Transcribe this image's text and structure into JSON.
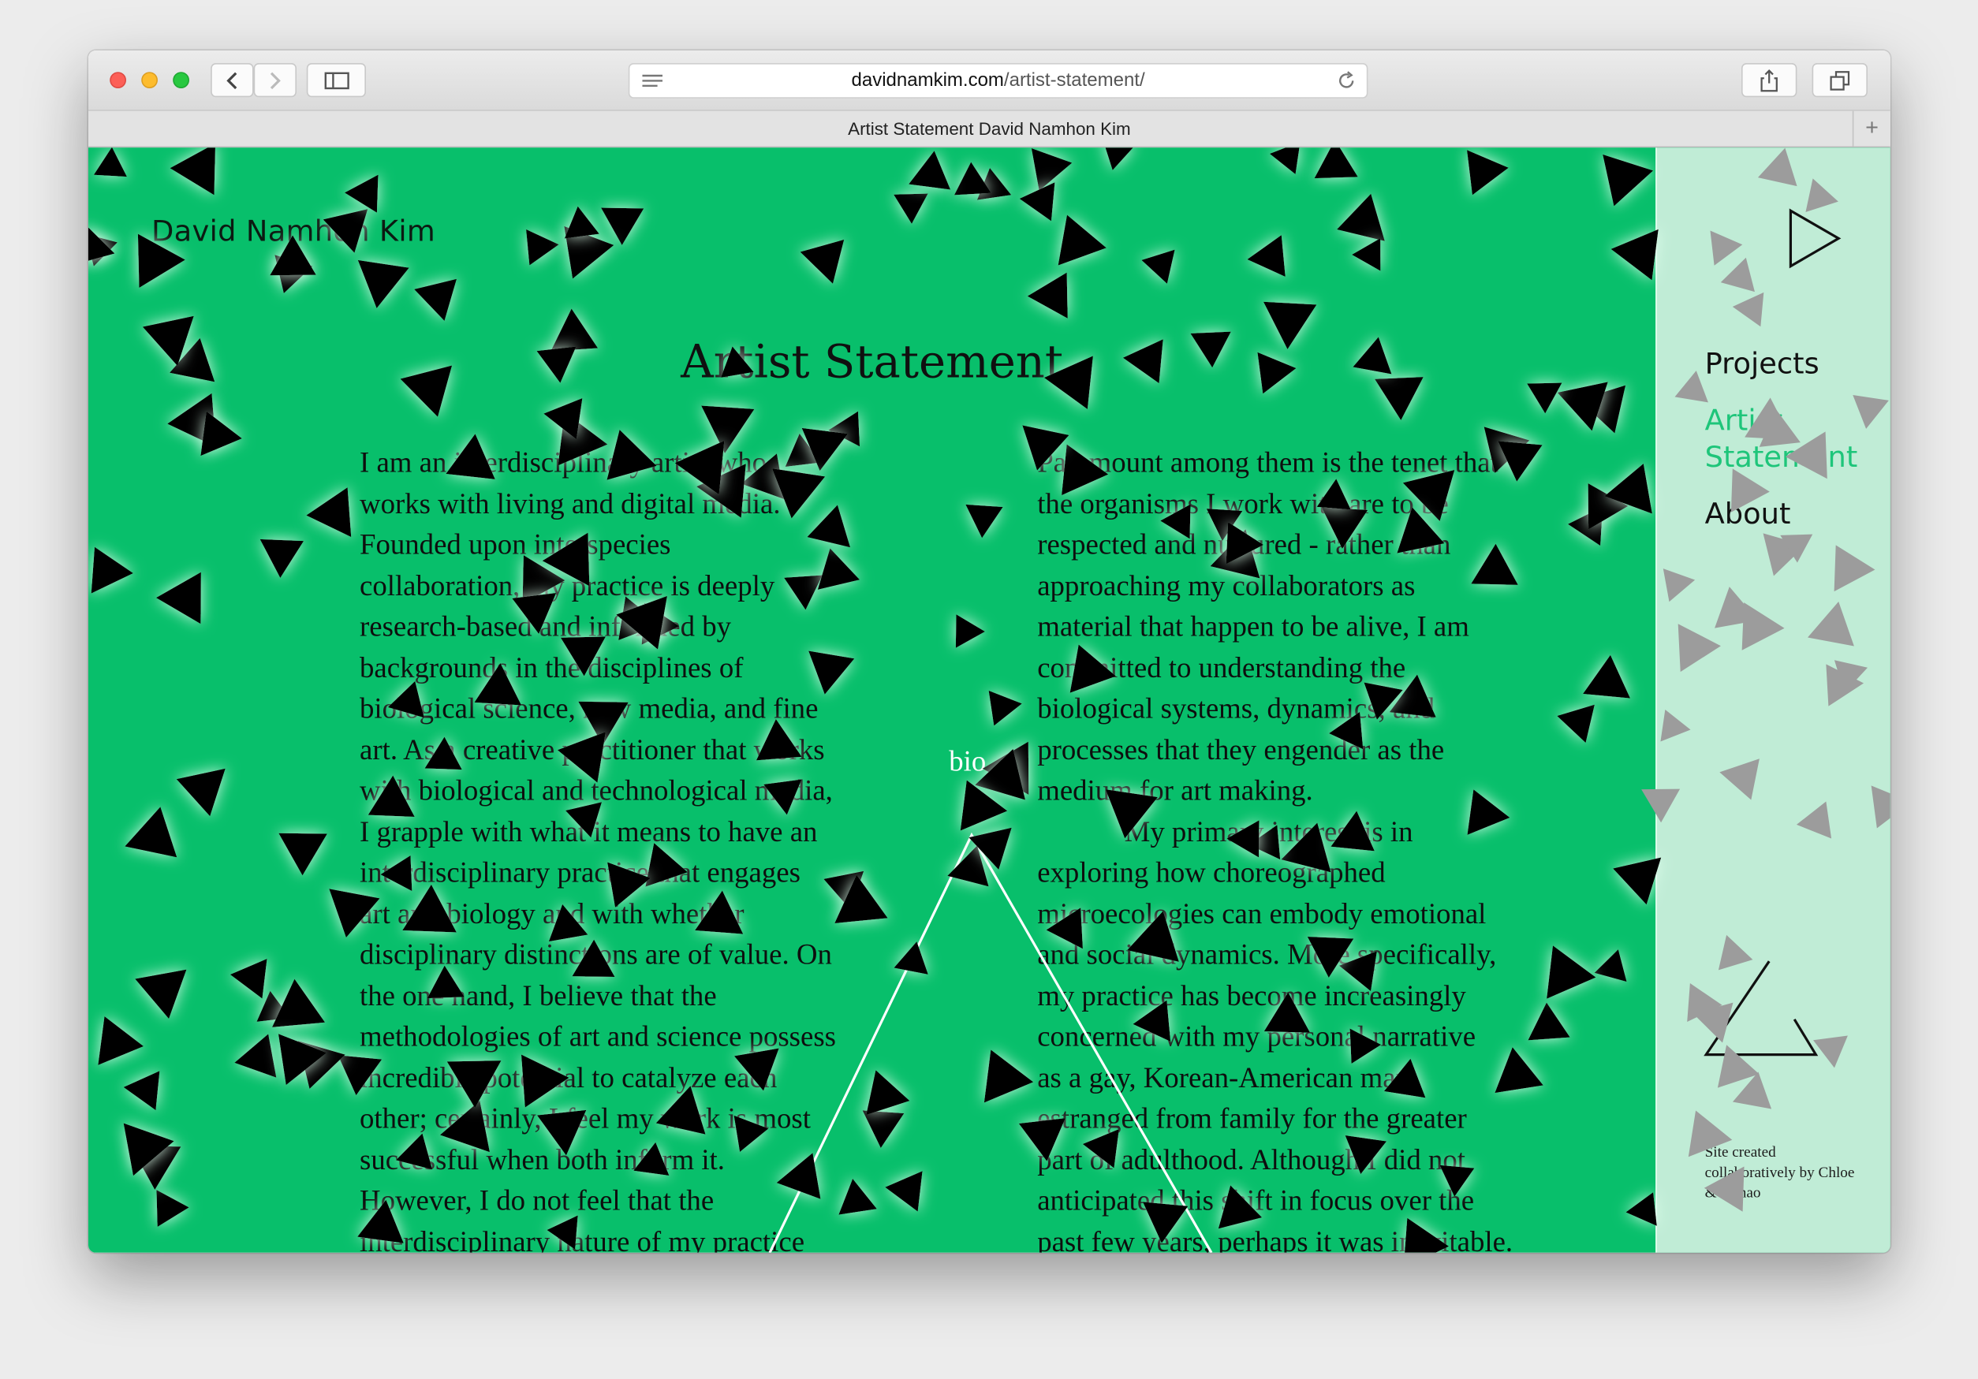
{
  "browser": {
    "url_domain": "davidnamkim.com",
    "url_path": "/artist-statement/",
    "tab_title": "Artist Statement David Namhon Kim",
    "new_tab_label": "+"
  },
  "site": {
    "name": "David Namhon Kim",
    "page_title": "Artist Statement",
    "bio_link": "bio",
    "credit": "Site created collaboratively by Chloe & chihao"
  },
  "nav": {
    "items": [
      {
        "label": "Projects"
      },
      {
        "label": "Artist Statement"
      },
      {
        "label": "About"
      }
    ]
  },
  "statement": {
    "col1_lines": [
      "I am an interdisciplinary artist who",
      "works with living and digital media.",
      "Founded upon interspecies",
      "collaboration, my practice is deeply",
      "research-based and informed by",
      "backgrounds in the disciplines of",
      "biological science, new media, and fine",
      "art. As a creative practitioner that works",
      "with biological and technological media,",
      "I grapple with what it means to have an",
      "interdisciplinary practice that engages",
      "art and biology and with whether",
      "disciplinary distinctions are of value. On",
      "the one hand, I believe that the",
      "methodologies of art and science possess",
      "incredible potential to catalyze each",
      "other; certainly, I feel my work is most",
      "successful when both inform it.",
      "However, I do not feel that the",
      "interdisciplinary nature of my practice"
    ],
    "col2_lines": [
      "Paramount among them is the tenet that",
      "the organisms I work with are to be",
      "respected and nurtured - rather than",
      "approaching my collaborators as",
      "material that happen to be alive, I am",
      "committed to understanding the",
      "biological systems, dynamics, and",
      "processes that they engender as the",
      "medium for art making.",
      "   My primary interest is in",
      "exploring how choreographed",
      "microecologies can embody emotional",
      "and social dynamics. More specifically,",
      "my practice has become increasingly",
      "concerned with my personal narrative",
      "as a gay, Korean-American man",
      "estranged from family for the greater",
      "part of adulthood. Although I did not",
      "anticipated this shift in focus over the",
      "past few years, perhaps it was inevitable."
    ]
  },
  "icons": {
    "play": "play-triangle-icon",
    "triangle": "outline-triangle-icon",
    "decor": "falling-triangle-particles"
  },
  "colors": {
    "page_bg": "#08bf6b",
    "sidebar_bg": "#c0ecd6",
    "nav_active": "#1ec57a",
    "particle": "#000000",
    "particle_sidebar": "#9c9c9c"
  }
}
